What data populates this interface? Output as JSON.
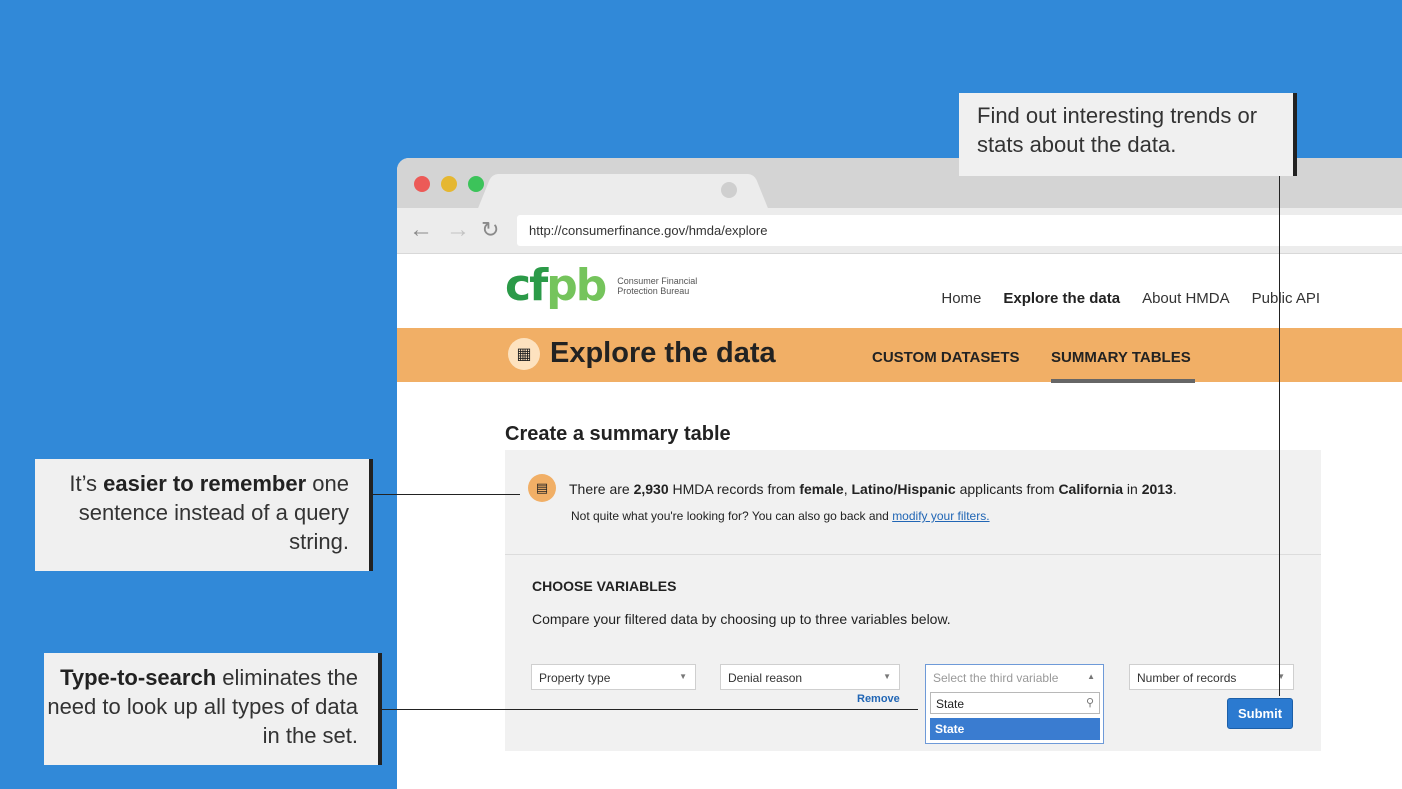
{
  "browser": {
    "url": "http://consumerfinance.gov/hmda/explore"
  },
  "site": {
    "logo_mark": "cfpb",
    "logo_text": "Consumer Financial Protection Bureau",
    "nav": [
      "Home",
      "Explore the data",
      "About HMDA",
      "Public API"
    ]
  },
  "banner": {
    "title": "Explore the data",
    "tabs": [
      "CUSTOM DATASETS",
      "SUMMARY TABLES"
    ]
  },
  "main": {
    "title": "Create a summary table",
    "summary": {
      "p1": "There are ",
      "count": "2,930",
      "p2": " HMDA records from ",
      "sex": "female",
      "p3": ", ",
      "ethnicity": "Latino/Hispanic",
      "p4": " applicants from ",
      "state": "California",
      "p5": " in ",
      "year": "2013",
      "p6": ".",
      "sub": "Not quite what you're looking for? You can also go back and ",
      "sub_link": "modify your filters."
    },
    "choose_heading": "CHOOSE VARIABLES",
    "choose_desc": "Compare your filtered data by choosing up to three variables below.",
    "selects": [
      "Property type",
      "Denial reason",
      "Select the third variable",
      "Number of records"
    ],
    "remove_label": "Remove",
    "dropdown": {
      "search_value": "State",
      "option": "State"
    },
    "submit_label": "Submit"
  },
  "callouts": {
    "top": "Find out interesting trends or stats about the data.",
    "mid_pre": "It’s ",
    "mid_bold": "easier to remember",
    "mid_post": " one sentence instead of a query string.",
    "bot_bold": "Type-to-search",
    "bot_post": " eliminates the need to look up all types of data in the set."
  },
  "colors": {
    "background": "#3189d8",
    "banner": "#f1af66",
    "link": "#2166b5",
    "submit": "#2b7ad0"
  }
}
